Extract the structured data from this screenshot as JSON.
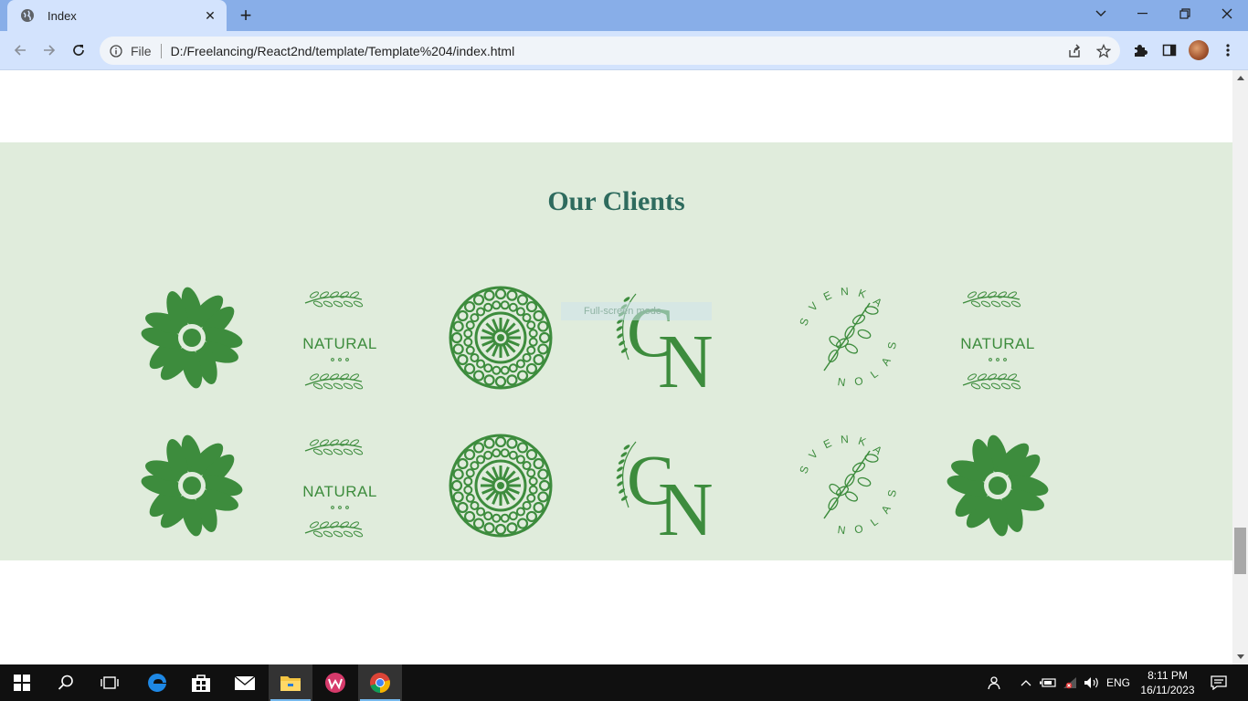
{
  "browser": {
    "tab_title": "Index",
    "url_scheme_label": "File",
    "url": "D:/Freelancing/React2nd/template/Template%204/index.html"
  },
  "page": {
    "section_title": "Our Clients",
    "tooltip_text": "Full-screen mode",
    "logos": [
      {
        "kind": "flower-logo"
      },
      {
        "kind": "natural-logo",
        "text": "NATURAL"
      },
      {
        "kind": "mandala-logo"
      },
      {
        "kind": "cn-logo",
        "text": "CN"
      },
      {
        "kind": "svenka-salon-logo",
        "text": "SVENKA SALON"
      },
      {
        "kind": "natural-logo",
        "text": "NATURAL"
      },
      {
        "kind": "flower-logo"
      },
      {
        "kind": "natural-logo",
        "text": "NATURAL"
      },
      {
        "kind": "mandala-logo"
      },
      {
        "kind": "cn-logo",
        "text": "CN"
      },
      {
        "kind": "svenka-salon-logo",
        "text": "SVENKA SALON"
      },
      {
        "kind": "flower-logo"
      }
    ]
  },
  "taskbar": {
    "language": "ENG",
    "time": "8:11 PM",
    "date": "16/11/2023"
  },
  "colors": {
    "brand_green": "#3d8c3d",
    "section_bg": "#e0ecdc",
    "title_color": "#2e6b5e"
  }
}
